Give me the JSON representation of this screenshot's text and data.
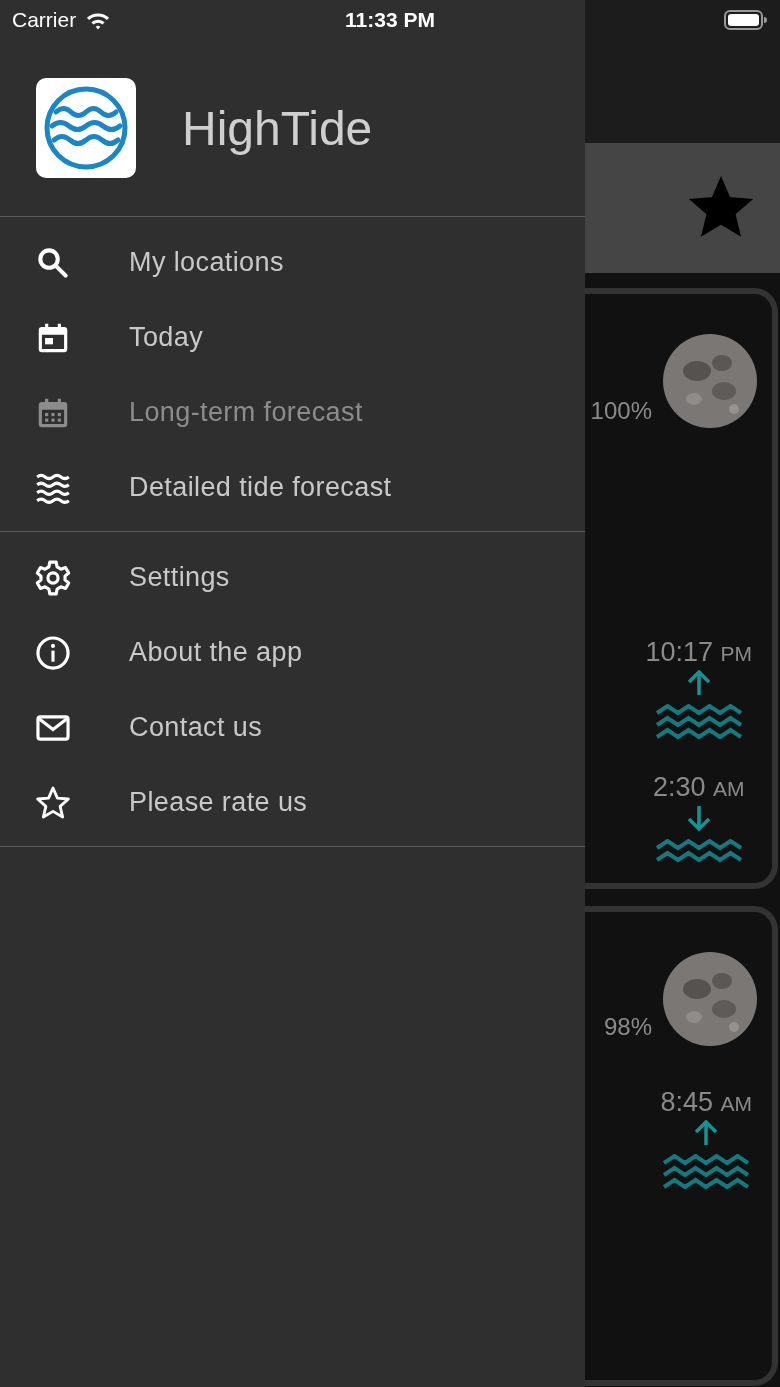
{
  "status_bar": {
    "carrier": "Carrier",
    "time": "11:33 PM"
  },
  "drawer": {
    "app_name": "HighTide",
    "groups": [
      {
        "items": [
          {
            "kind": "search",
            "label": "My locations",
            "disabled": false
          },
          {
            "kind": "calendar-day",
            "label": "Today",
            "disabled": false
          },
          {
            "kind": "calendar-grid",
            "label": "Long-term forecast",
            "disabled": true
          },
          {
            "kind": "waves",
            "label": "Detailed tide forecast",
            "disabled": false
          }
        ]
      },
      {
        "items": [
          {
            "kind": "gear",
            "label": "Settings",
            "disabled": false
          },
          {
            "kind": "info",
            "label": "About the app",
            "disabled": false
          },
          {
            "kind": "envelope",
            "label": "Contact us",
            "disabled": false
          },
          {
            "kind": "star",
            "label": "Please rate us",
            "disabled": false
          }
        ]
      }
    ]
  },
  "background_screen": {
    "favorite": true,
    "cards": [
      {
        "illumination": "100%",
        "tides": [
          {
            "kind": "high",
            "time": "10:17",
            "meridiem": "PM"
          },
          {
            "kind": "low",
            "time": "2:30",
            "meridiem": "AM"
          }
        ]
      },
      {
        "illumination": "98%",
        "tides": [
          {
            "kind": "high",
            "time": "8:45",
            "meridiem": "AM"
          }
        ]
      }
    ]
  }
}
